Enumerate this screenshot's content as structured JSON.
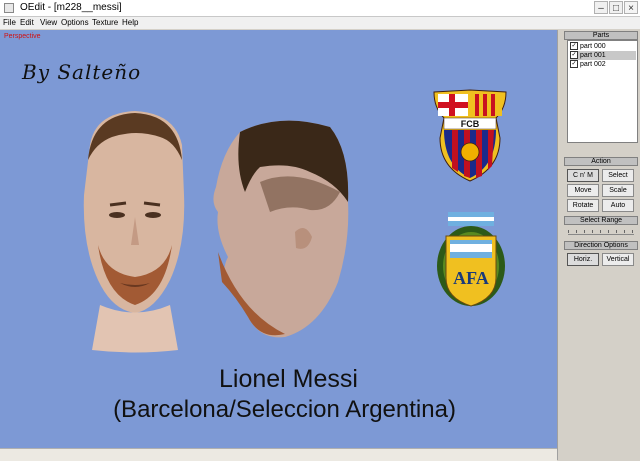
{
  "window": {
    "title": "OEdit - [m228__messi]",
    "minimize": "–",
    "maximize": "□",
    "close": "×"
  },
  "menu": [
    "File",
    "Edit",
    "View",
    "Options",
    "Texture",
    "Help"
  ],
  "viewport": {
    "mode_label": "Perspective",
    "byline": "By Salteño",
    "caption_line1": "Lionel Messi",
    "caption_line2": "(Barcelona/Seleccion Argentina)",
    "background": "#7d99d5",
    "badges": [
      {
        "name": "barcelona-crest",
        "text": "FCB"
      },
      {
        "name": "afa-crest",
        "text": "AFA"
      }
    ]
  },
  "panel": {
    "parts_header": "Parts",
    "parts": [
      {
        "label": "part 000",
        "checked": true,
        "selected": false
      },
      {
        "label": "part 001",
        "checked": true,
        "selected": true
      },
      {
        "label": "part 002",
        "checked": true,
        "selected": false
      }
    ],
    "action_header": "Action",
    "actions": [
      "C n' M",
      "Select",
      "Move",
      "Scale",
      "Rotate",
      "Auto"
    ],
    "select_range_header": "Select Range",
    "direction_header": "Direction Options",
    "directions": [
      "Horiz.",
      "Vertical"
    ]
  }
}
